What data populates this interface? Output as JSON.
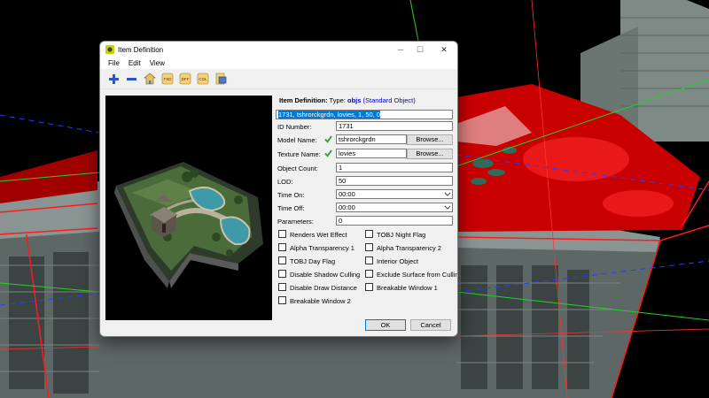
{
  "window": {
    "title": "Item Definition",
    "controls": [
      "─",
      "☐",
      "✕"
    ]
  },
  "menu": [
    "File",
    "Edit",
    "View"
  ],
  "toolbar": {
    "buttons": [
      {
        "icon": "plus-icon"
      },
      {
        "icon": "minus-icon"
      },
      {
        "icon": "house-icon"
      },
      {
        "icon": "txd-icon",
        "label": "TXD"
      },
      {
        "icon": "dff-icon",
        "label": "DFF"
      },
      {
        "icon": "col-icon",
        "label": "COL"
      },
      {
        "icon": "export-icon"
      }
    ]
  },
  "header": {
    "label": "Item Definition:",
    "type_prefix": "Type:",
    "type_value": "objs",
    "type_desc": "(Standard Object)"
  },
  "definition_line": "1731, tshrorckgrdn, lovies, 1, 50, 0",
  "fields": {
    "id_number": {
      "label": "ID Number:",
      "value": "1731"
    },
    "model_name": {
      "label": "Model Name:",
      "value": "tshrorckgrdn",
      "browse": "Browse..."
    },
    "texture_name": {
      "label": "Texture Name:",
      "value": "lovies",
      "browse": "Browse..."
    },
    "object_count": {
      "label": "Object Count:",
      "value": "1"
    },
    "lod": {
      "label": "LOD:",
      "value": "50"
    },
    "time_on": {
      "label": "Time On:",
      "value": "00:00"
    },
    "time_off": {
      "label": "Time Off:",
      "value": "00:00"
    },
    "parameters": {
      "label": "Parameters:",
      "value": "0"
    }
  },
  "flags": [
    "Renders Wet Effect",
    "TOBJ Night Flag",
    "Alpha Transparency 1",
    "Alpha Transparency 2",
    "TOBJ Day Flag",
    "Interior Object",
    "Disable Shadow Culling",
    "Exclude Surface from Culling",
    "Disable Draw Distance",
    "Breakable Window 1",
    "Breakable Window 2"
  ],
  "buttons": {
    "ok": "OK",
    "cancel": "Cancel"
  },
  "colors": {
    "accent": "#0078d7",
    "link_blue": "#0000c8",
    "check_green": "#3aa63a",
    "roof_red": "#d40000"
  }
}
